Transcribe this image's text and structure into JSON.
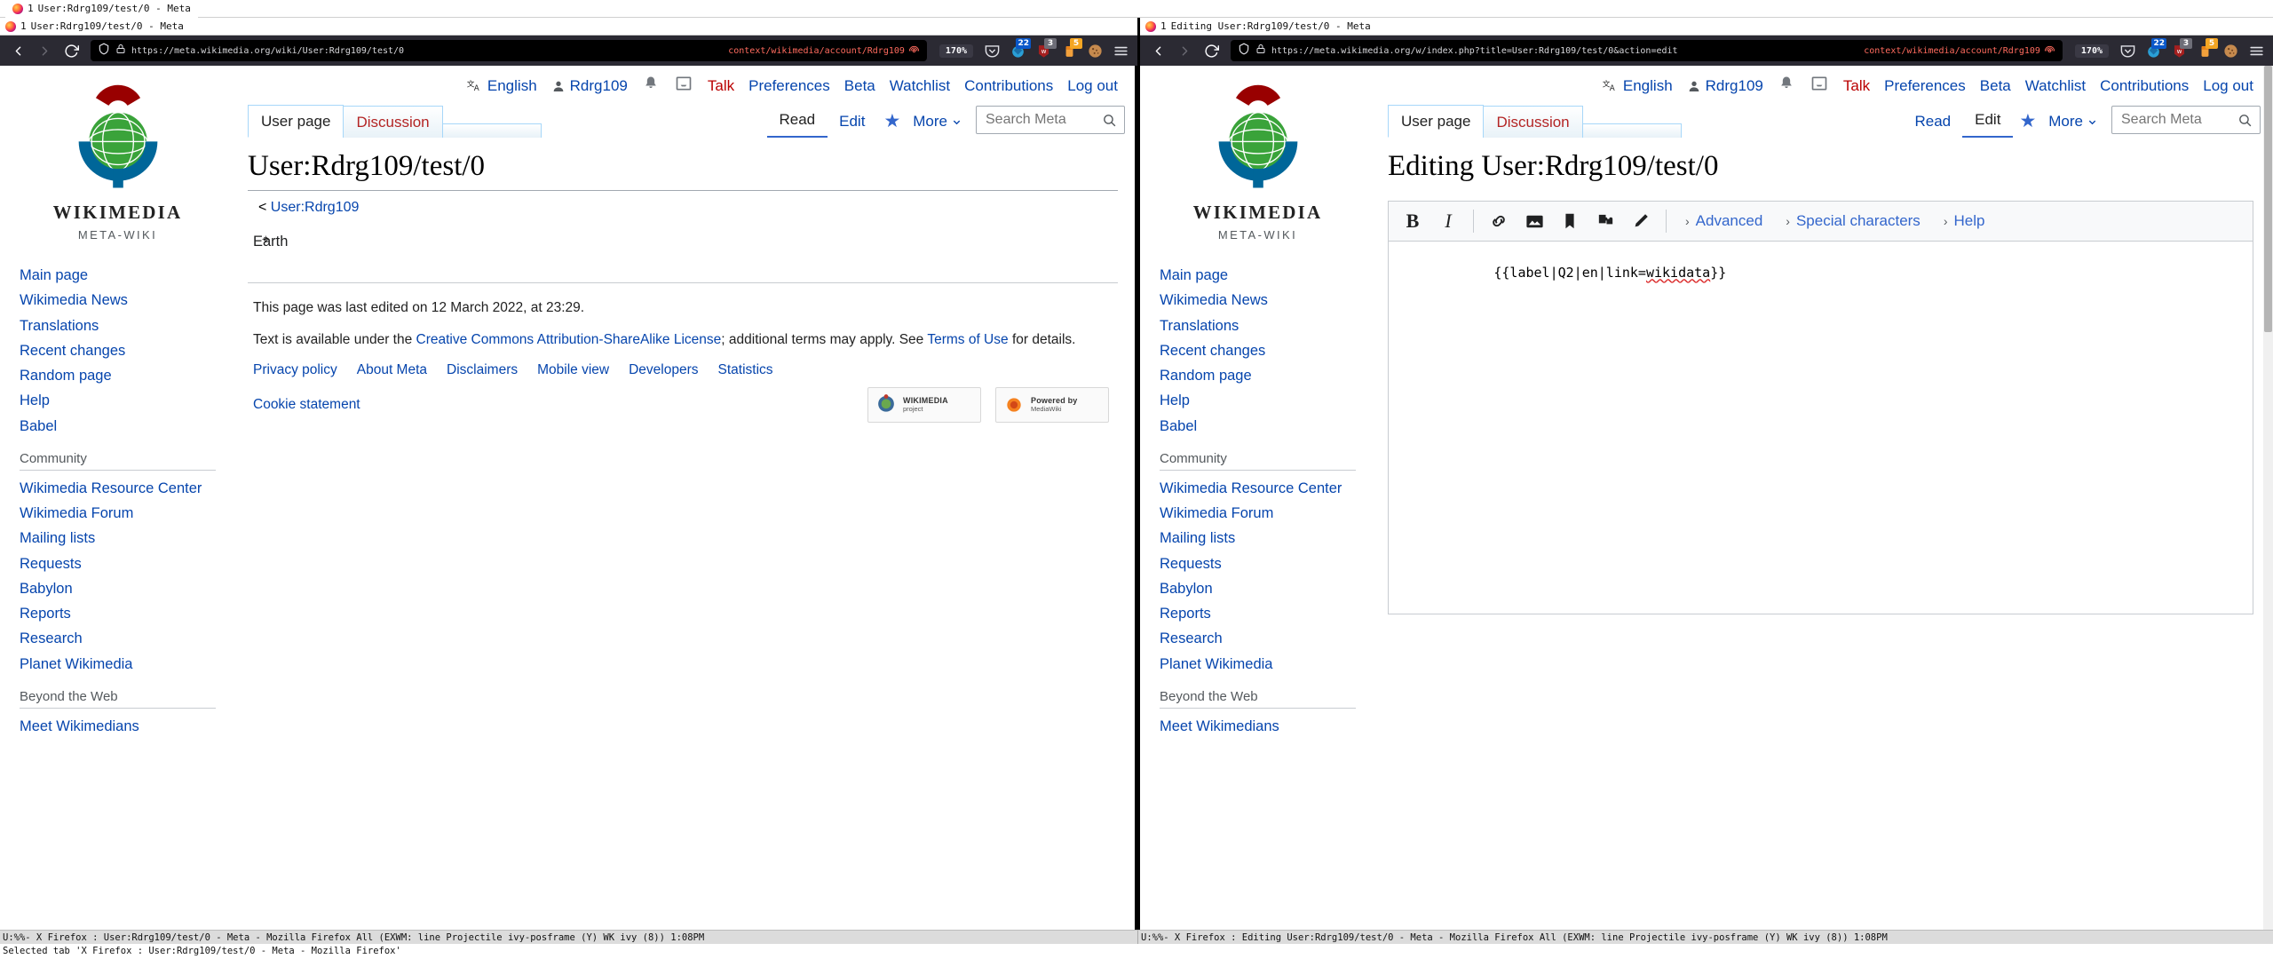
{
  "wm": {
    "tabline": {
      "index": "1",
      "title": "User:Rdrg109/test/0 - Meta",
      "icon": "firefox-icon"
    },
    "modeline_left": "U:%%- X Firefox : User:Rdrg109/test/0 - Meta - Mozilla Firefox   All  (EXWM: line Projectile ivy-posframe (Y) WK ivy (8)) 1:08PM",
    "modeline_right": "U:%%- X Firefox : Editing User:Rdrg109/test/0 - Meta - Mozilla Firefox   All  (EXWM: line Projectile ivy-posframe (Y) WK ivy (8)) 1:08PM",
    "minibuffer": "Selected tab 'X Firefox : User:Rdrg109/test/0 - Meta - Mozilla Firefox'"
  },
  "windows": {
    "left": {
      "tab": {
        "index": "1",
        "title": "User:Rdrg109/test/0 - Meta"
      },
      "browser": {
        "back_label": "Back",
        "forward_label": "Forward",
        "reload_label": "Reload",
        "url": "https://meta.wikimedia.org/wiki/User:Rdrg109/test/0",
        "container": "context/wikimedia/account/Rdrg109",
        "zoom": "170%",
        "extensions": [
          {
            "name": "pocket-icon",
            "badge": ""
          },
          {
            "name": "extension-icon-blue",
            "badge": "22"
          },
          {
            "name": "extension-icon-red",
            "badge": "3"
          },
          {
            "name": "extension-icon-orange",
            "badge": "5"
          },
          {
            "name": "cookie-icon",
            "badge": ""
          },
          {
            "name": "hamburger-menu-icon",
            "badge": ""
          }
        ]
      },
      "wiki": {
        "personal": [
          {
            "label": "English",
            "icon": "language-icon",
            "style": "link"
          },
          {
            "label": "Rdrg109",
            "icon": "user-icon",
            "style": "link"
          },
          {
            "label": "",
            "icon": "bell-icon",
            "style": "icon"
          },
          {
            "label": "",
            "icon": "tray-icon",
            "style": "icon"
          },
          {
            "label": "Talk",
            "icon": "",
            "style": "new"
          },
          {
            "label": "Preferences",
            "icon": "",
            "style": "link"
          },
          {
            "label": "Beta",
            "icon": "",
            "style": "link"
          },
          {
            "label": "Watchlist",
            "icon": "",
            "style": "link"
          },
          {
            "label": "Contributions",
            "icon": "",
            "style": "link"
          },
          {
            "label": "Log out",
            "icon": "",
            "style": "link"
          }
        ],
        "ns_tabs": [
          {
            "label": "User page",
            "state": "selected"
          },
          {
            "label": "Discussion",
            "state": "new"
          }
        ],
        "view_tabs": [
          {
            "label": "Read",
            "state": "selected"
          },
          {
            "label": "Edit",
            "state": "link"
          }
        ],
        "star_icon": "star-icon",
        "more_label": "More",
        "search_placeholder": "Search Meta",
        "search_value": "",
        "title": "User:Rdrg109/test/0",
        "subtitle_prefix": "<",
        "subtitle_link": "User:Rdrg109",
        "content": "Earth",
        "footer": {
          "last_edited": "This page was last edited on 12 March 2022, at 23:29.",
          "license_pre": "Text is available under the ",
          "license_link": "Creative Commons Attribution-ShareAlike License",
          "license_mid": "; additional terms may apply. See ",
          "terms_link": "Terms of Use",
          "license_post": " for details.",
          "links": [
            "Privacy policy",
            "About Meta",
            "Disclaimers",
            "Mobile view",
            "Developers",
            "Statistics"
          ],
          "cookie": "Cookie statement",
          "badge_wikimedia_title": "WIKIMEDIA",
          "badge_wikimedia_sub": "project",
          "badge_mediawiki_title": "Powered by",
          "badge_mediawiki_sub": "MediaWiki"
        },
        "sidebar": {
          "logo_word": "WIKIMEDIA",
          "logo_sub": "META-WIKI",
          "sections": [
            {
              "heading": "",
              "items": [
                "Main page",
                "Wikimedia News",
                "Translations",
                "Recent changes",
                "Random page",
                "Help",
                "Babel"
              ]
            },
            {
              "heading": "Community",
              "items": [
                "Wikimedia Resource Center",
                "Wikimedia Forum",
                "Mailing lists",
                "Requests",
                "Babylon",
                "Reports",
                "Research",
                "Planet Wikimedia"
              ]
            },
            {
              "heading": "Beyond the Web",
              "items": [
                "Meet Wikimedians"
              ]
            }
          ]
        }
      }
    },
    "right": {
      "tab": {
        "index": "1",
        "title": "Editing User:Rdrg109/test/0 - Meta"
      },
      "browser": {
        "url": "https://meta.wikimedia.org/w/index.php?title=User:Rdrg109/test/0&action=edit",
        "container": "context/wikimedia/account/Rdrg109",
        "zoom": "170%",
        "extensions": [
          {
            "name": "pocket-icon",
            "badge": ""
          },
          {
            "name": "extension-icon-blue",
            "badge": "22"
          },
          {
            "name": "extension-icon-red",
            "badge": "3"
          },
          {
            "name": "extension-icon-orange",
            "badge": "5"
          },
          {
            "name": "cookie-icon",
            "badge": ""
          },
          {
            "name": "hamburger-menu-icon",
            "badge": ""
          }
        ]
      },
      "wiki": {
        "personal": [
          {
            "label": "English",
            "icon": "language-icon",
            "style": "link"
          },
          {
            "label": "Rdrg109",
            "icon": "user-icon",
            "style": "link"
          },
          {
            "label": "",
            "icon": "bell-icon",
            "style": "icon"
          },
          {
            "label": "",
            "icon": "tray-icon",
            "style": "icon"
          },
          {
            "label": "Talk",
            "icon": "",
            "style": "new"
          },
          {
            "label": "Preferences",
            "icon": "",
            "style": "link"
          },
          {
            "label": "Beta",
            "icon": "",
            "style": "link"
          },
          {
            "label": "Watchlist",
            "icon": "",
            "style": "link"
          },
          {
            "label": "Contributions",
            "icon": "",
            "style": "link"
          },
          {
            "label": "Log out",
            "icon": "",
            "style": "link"
          }
        ],
        "ns_tabs": [
          {
            "label": "User page",
            "state": "link"
          },
          {
            "label": "Discussion",
            "state": "new"
          }
        ],
        "view_tabs": [
          {
            "label": "Read",
            "state": "link"
          },
          {
            "label": "Edit",
            "state": "selected"
          }
        ],
        "star_icon": "star-icon",
        "more_label": "More",
        "search_placeholder": "Search Meta",
        "search_value": "",
        "title": "Editing User:Rdrg109/test/0",
        "editor": {
          "toolbar_buttons": [
            {
              "name": "bold-button",
              "glyph": "B"
            },
            {
              "name": "italic-button",
              "glyph": "I"
            },
            {
              "name": "link-button",
              "glyph": "link"
            },
            {
              "name": "image-button",
              "glyph": "image"
            },
            {
              "name": "reference-button",
              "glyph": "book"
            },
            {
              "name": "template-button",
              "glyph": "puzzle"
            },
            {
              "name": "signature-button",
              "glyph": "pencil"
            }
          ],
          "menus": [
            {
              "label": "Advanced"
            },
            {
              "label": "Special characters"
            },
            {
              "label": "Help"
            }
          ],
          "text": "{{label|Q2|en|link=wikidata}}",
          "misspelled": "wikidata"
        },
        "sidebar": {
          "logo_word": "WIKIMEDIA",
          "logo_sub": "META-WIKI",
          "sections": [
            {
              "heading": "",
              "items": [
                "Main page",
                "Wikimedia News",
                "Translations",
                "Recent changes",
                "Random page",
                "Help",
                "Babel"
              ]
            },
            {
              "heading": "Community",
              "items": [
                "Wikimedia Resource Center",
                "Wikimedia Forum",
                "Mailing lists",
                "Requests",
                "Babylon",
                "Reports",
                "Research",
                "Planet Wikimedia"
              ]
            },
            {
              "heading": "Beyond the Web",
              "items": [
                "Meet Wikimedians"
              ]
            }
          ]
        }
      }
    }
  },
  "colors": {
    "link": "#0645ad",
    "new_link": "#ba0000",
    "chrome_bg": "#2b2a33",
    "container_accent": "#ff6b5e",
    "wiki_red": "#990000",
    "wiki_green": "#3aa33a",
    "wiki_blue": "#006699"
  }
}
